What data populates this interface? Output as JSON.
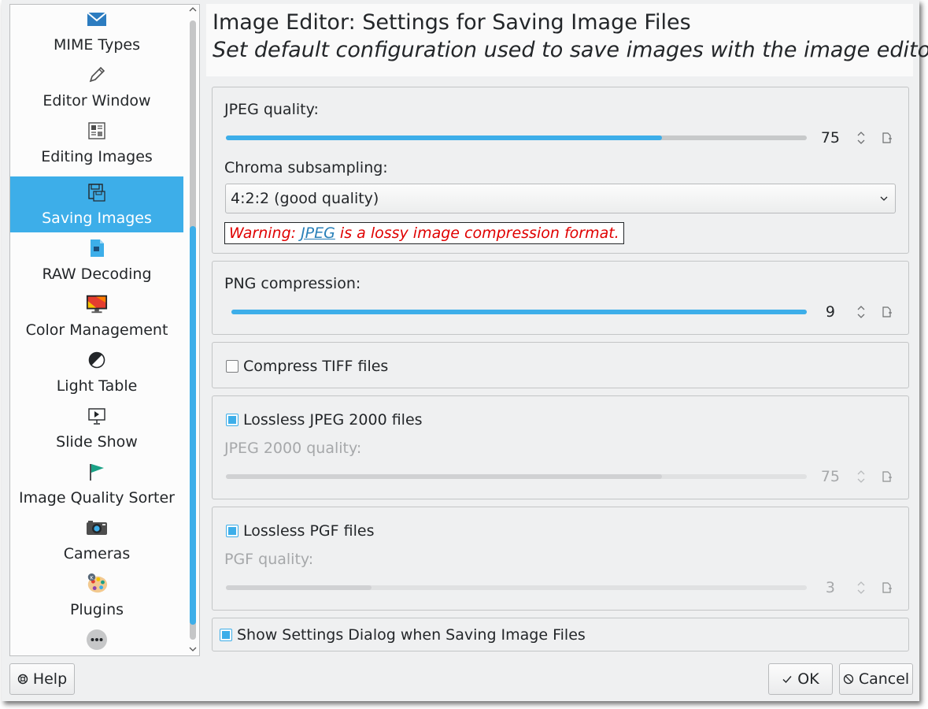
{
  "sidebar": {
    "items": [
      {
        "label": "MIME Types",
        "icon": "mime-types-icon"
      },
      {
        "label": "Editor Window",
        "icon": "pencil-icon"
      },
      {
        "label": "Editing Images",
        "icon": "editing-images-icon"
      },
      {
        "label": "Saving Images",
        "icon": "save-icon",
        "selected": true
      },
      {
        "label": "RAW Decoding",
        "icon": "raw-file-icon"
      },
      {
        "label": "Color Management",
        "icon": "monitor-color-icon"
      },
      {
        "label": "Light Table",
        "icon": "contrast-icon"
      },
      {
        "label": "Slide Show",
        "icon": "slideshow-icon"
      },
      {
        "label": "Image Quality Sorter",
        "icon": "flag-icon"
      },
      {
        "label": "Cameras",
        "icon": "camera-icon"
      },
      {
        "label": "Plugins",
        "icon": "plugins-palette-icon"
      }
    ],
    "more_icon": "more-icon"
  },
  "header": {
    "title": "Image Editor: Settings for Saving Image Files",
    "subtitle": "Set default configuration used to save images with the image editor"
  },
  "jpeg": {
    "quality_label": "JPEG quality:",
    "quality_value": "75",
    "quality_fraction": 0.75,
    "chroma_label": "Chroma subsampling:",
    "chroma_value": "4:2:2 (good quality)",
    "warning_prefix": "Warning: ",
    "warning_link": "JPEG",
    "warning_suffix": " is a lossy image compression format."
  },
  "png": {
    "compression_label": "PNG compression:",
    "compression_value": "9",
    "compression_fraction": 1.0
  },
  "tiff": {
    "compress_label": "Compress TIFF files",
    "checked": false
  },
  "jpeg2000": {
    "lossless_label": "Lossless JPEG 2000 files",
    "checked": true,
    "quality_label": "JPEG 2000 quality:",
    "quality_value": "75",
    "quality_fraction": 0.75
  },
  "pgf": {
    "lossless_label": "Lossless PGF files",
    "checked": true,
    "quality_label": "PGF quality:",
    "quality_value": "3",
    "quality_fraction": 0.25
  },
  "show_dialog": {
    "label": "Show Settings Dialog when Saving Image Files",
    "checked": true
  },
  "buttons": {
    "help": "Help",
    "ok": "OK",
    "cancel": "Cancel"
  },
  "colors": {
    "accent": "#3daee9",
    "warning": "#e00000",
    "link": "#2980b9"
  }
}
